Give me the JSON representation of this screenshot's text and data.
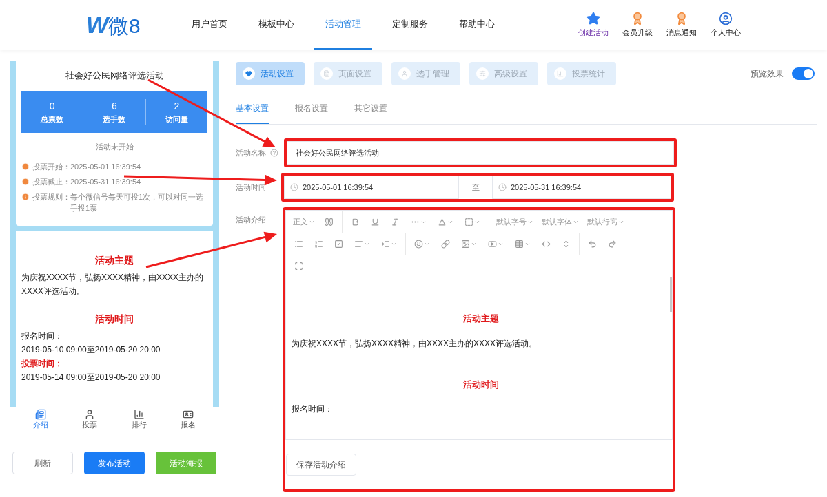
{
  "header": {
    "logo": {
      "mark": "W",
      "text": "微8"
    },
    "nav": [
      {
        "label": "用户首页",
        "selected": false
      },
      {
        "label": "模板中心",
        "selected": false
      },
      {
        "label": "活动管理",
        "selected": true
      },
      {
        "label": "定制服务",
        "selected": false
      },
      {
        "label": "帮助中心",
        "selected": false
      }
    ],
    "actions": [
      {
        "label": "创建活动",
        "kind": "stars",
        "highlighted": true
      },
      {
        "label": "会员升级",
        "kind": "badge",
        "highlighted": false
      },
      {
        "label": "消息通知",
        "kind": "badge",
        "highlighted": false
      },
      {
        "label": "个人中心",
        "kind": "user",
        "highlighted": false
      }
    ]
  },
  "preview": {
    "title": "社会好公民网络评选活动",
    "stats": [
      {
        "value": "0",
        "label": "总票数"
      },
      {
        "value": "6",
        "label": "选手数"
      },
      {
        "value": "2",
        "label": "访问量"
      }
    ],
    "status": "活动未开始",
    "info": [
      {
        "kind": "clock",
        "label": "投票开始：",
        "value": "2025-05-01 16:39:54"
      },
      {
        "kind": "clock",
        "label": "投票截止：",
        "value": "2025-05-31 16:39:54"
      },
      {
        "kind": "info",
        "label": "投票规则：",
        "value": "每个微信号每天可投1次，可以对同一选手投1票"
      }
    ],
    "content": [
      {
        "kind": "heading",
        "text": "活动主题"
      },
      {
        "kind": "paragraph",
        "text": "为庆祝XXXX节，弘扬XXXX精神，由XXXX主办的XXXX评选活动。"
      },
      {
        "kind": "heading",
        "text": "活动时间"
      },
      {
        "kind": "paragraph",
        "text": "报名时间："
      },
      {
        "kind": "paragraph",
        "text": "2019-05-10 09:00至2019-05-20 20:00"
      },
      {
        "kind": "label",
        "text": "投票时间："
      },
      {
        "kind": "paragraph",
        "text": "2019-05-14 09:00至2019-05-20 20:00"
      }
    ],
    "tabbar": [
      {
        "label": "介绍",
        "kind": "doc",
        "selected": true
      },
      {
        "label": "投票",
        "kind": "user",
        "selected": false
      },
      {
        "label": "排行",
        "kind": "rank",
        "selected": false
      },
      {
        "label": "报名",
        "kind": "card",
        "selected": false
      }
    ],
    "buttons": [
      {
        "label": "刷新",
        "kind": "plain"
      },
      {
        "label": "发布活动",
        "kind": "primary"
      },
      {
        "label": "活动海报",
        "kind": "success"
      }
    ]
  },
  "steps": [
    {
      "label": "活动设置",
      "kind": "heart",
      "selected": true
    },
    {
      "label": "页面设置",
      "kind": "page",
      "selected": false
    },
    {
      "label": "选手管理",
      "kind": "user",
      "selected": false
    },
    {
      "label": "高级设置",
      "kind": "sliders",
      "selected": false
    },
    {
      "label": "投票统计",
      "kind": "chart",
      "selected": false
    }
  ],
  "preview_toggle": {
    "label": "预览效果",
    "on": true
  },
  "subtabs": [
    {
      "label": "基本设置",
      "selected": true
    },
    {
      "label": "报名设置",
      "selected": false
    },
    {
      "label": "其它设置",
      "selected": false
    }
  ],
  "form": {
    "name": {
      "label": "活动名称",
      "value": "社会好公民网络评选活动"
    },
    "time": {
      "label": "活动时间",
      "start": "2025-05-01 16:39:54",
      "separator": "至",
      "end": "2025-05-31 16:39:54"
    },
    "intro": {
      "label": "活动介绍",
      "toolbar": [
        [
          [
            {
              "kind": "dropdown",
              "label": "正文"
            },
            {
              "kind": "quote",
              "caret": false
            }
          ],
          [
            {
              "kind": "bold",
              "caret": false
            },
            {
              "kind": "underline",
              "caret": false
            },
            {
              "kind": "italic",
              "caret": false
            },
            {
              "kind": "more",
              "caret": true
            },
            {
              "kind": "fontcolor",
              "caret": true
            },
            {
              "kind": "bgcolor",
              "caret": true
            }
          ],
          [
            {
              "kind": "dropdown",
              "label": "默认字号"
            },
            {
              "kind": "dropdown",
              "label": "默认字体"
            },
            {
              "kind": "dropdown",
              "label": "默认行高"
            }
          ]
        ],
        [
          [
            {
              "kind": "bullets",
              "caret": false
            },
            {
              "kind": "numbers",
              "caret": false
            },
            {
              "kind": "todo",
              "caret": false
            },
            {
              "kind": "align",
              "caret": true
            },
            {
              "kind": "indent",
              "caret": true
            }
          ],
          [
            {
              "kind": "emoji",
              "caret": true
            },
            {
              "kind": "link",
              "caret": false
            },
            {
              "kind": "image",
              "caret": true
            },
            {
              "kind": "video",
              "caret": true
            },
            {
              "kind": "table",
              "caret": true
            },
            {
              "kind": "code",
              "caret": false
            },
            {
              "kind": "divider",
              "caret": false
            }
          ],
          [
            {
              "kind": "undo",
              "caret": false
            },
            {
              "kind": "redo",
              "caret": false
            }
          ]
        ],
        [
          [
            {
              "kind": "fullscreen",
              "caret": false
            }
          ]
        ]
      ],
      "content": [
        {
          "kind": "heading",
          "text": "活动主题"
        },
        {
          "kind": "paragraph",
          "text": "为庆祝XXXX节，弘扬XXXX精神，由XXXX主办的XXXX评选活动。"
        },
        {
          "kind": "heading",
          "text": "活动时间"
        },
        {
          "kind": "paragraph",
          "text": "报名时间："
        }
      ],
      "save": "保存活动介绍"
    }
  }
}
